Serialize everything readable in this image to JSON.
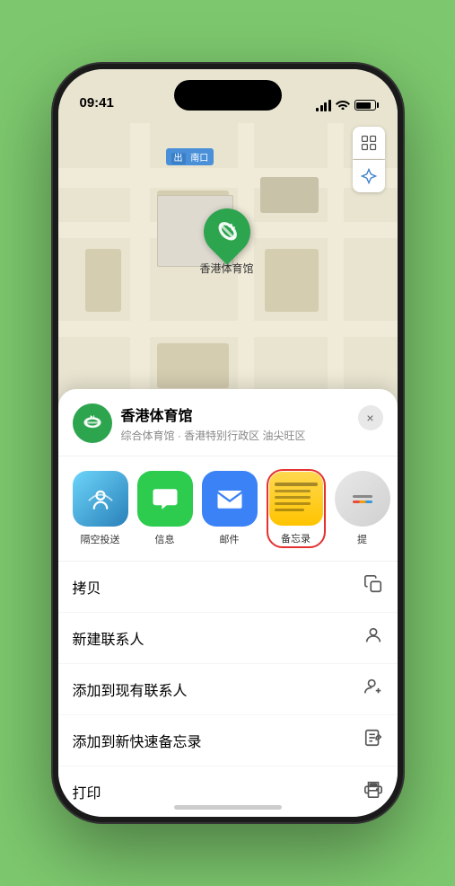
{
  "phone": {
    "status_bar": {
      "time": "09:41",
      "location_arrow": "➤"
    }
  },
  "map": {
    "label": "南口",
    "controls": {
      "map_type": "⊞",
      "location": "➤"
    },
    "marker_label": "香港体育馆"
  },
  "place_card": {
    "name": "香港体育馆",
    "subtitle": "综合体育馆 · 香港特别行政区 油尖旺区",
    "close_label": "×"
  },
  "share_items": [
    {
      "id": "airdrop",
      "label": "隔空投送",
      "type": "airdrop"
    },
    {
      "id": "messages",
      "label": "信息",
      "type": "messages"
    },
    {
      "id": "mail",
      "label": "邮件",
      "type": "mail"
    },
    {
      "id": "notes",
      "label": "备忘录",
      "type": "notes",
      "highlighted": true
    },
    {
      "id": "more",
      "label": "提",
      "type": "more"
    }
  ],
  "actions": [
    {
      "id": "copy",
      "label": "拷贝",
      "icon": "copy"
    },
    {
      "id": "new-contact",
      "label": "新建联系人",
      "icon": "person"
    },
    {
      "id": "add-contact",
      "label": "添加到现有联系人",
      "icon": "person-add"
    },
    {
      "id": "quick-note",
      "label": "添加到新快速备忘录",
      "icon": "note"
    },
    {
      "id": "print",
      "label": "打印",
      "icon": "print"
    }
  ]
}
